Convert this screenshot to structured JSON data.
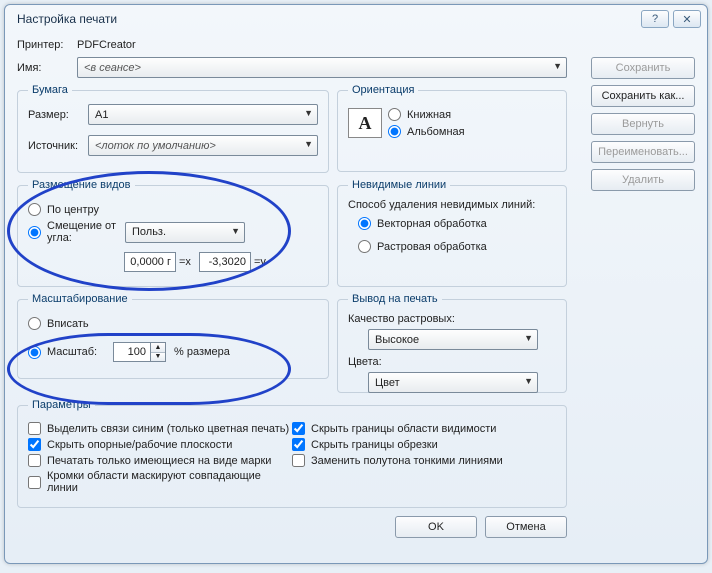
{
  "title": "Настройка печати",
  "printer_label": "Принтер:",
  "printer_value": "PDFCreator",
  "name_label": "Имя:",
  "name_value": "<в сеансе>",
  "btns": {
    "save": "Сохранить",
    "saveas": "Сохранить как...",
    "revert": "Вернуть",
    "rename": "Переименовать...",
    "delete": "Удалить",
    "ok": "OK",
    "cancel": "Отмена"
  },
  "paper": {
    "legend": "Бумага",
    "size_label": "Размер:",
    "size_value": "A1",
    "source_label": "Источник:",
    "source_value": "<лоток по умолчанию>"
  },
  "orient": {
    "legend": "Ориентация",
    "portrait": "Книжная",
    "landscape": "Альбомная"
  },
  "place": {
    "legend": "Размещение видов",
    "center": "По центру",
    "offset": "Смещение от угла:",
    "offset_sel": "Польз.",
    "x": "0,0000 г",
    "xl": "=x",
    "y": "-3,3020",
    "yl": "=y"
  },
  "hidden": {
    "legend": "Невидимые линии",
    "mode": "Способ удаления невидимых линий:",
    "vec": "Векторная обработка",
    "rast": "Растровая обработка"
  },
  "scale": {
    "legend": "Масштабирование",
    "fit": "Вписать",
    "scale": "Масштаб:",
    "val": "100",
    "pct": "% размера"
  },
  "output": {
    "legend": "Вывод на печать",
    "quality_l": "Качество растровых:",
    "quality_v": "Высокое",
    "colors_l": "Цвета:",
    "colors_v": "Цвет"
  },
  "params": {
    "legend": "Параметры",
    "c1": "Выделить связи синим (только цветная печать)",
    "c2": "Скрыть опорные/рабочие плоскости",
    "c3": "Печатать только имеющиеся на виде марки",
    "c4": "Кромки области маскируют совпадающие линии",
    "c5": "Скрыть границы области видимости",
    "c6": "Скрыть границы обрезки",
    "c7": "Заменить полутона тонкими линиями"
  }
}
